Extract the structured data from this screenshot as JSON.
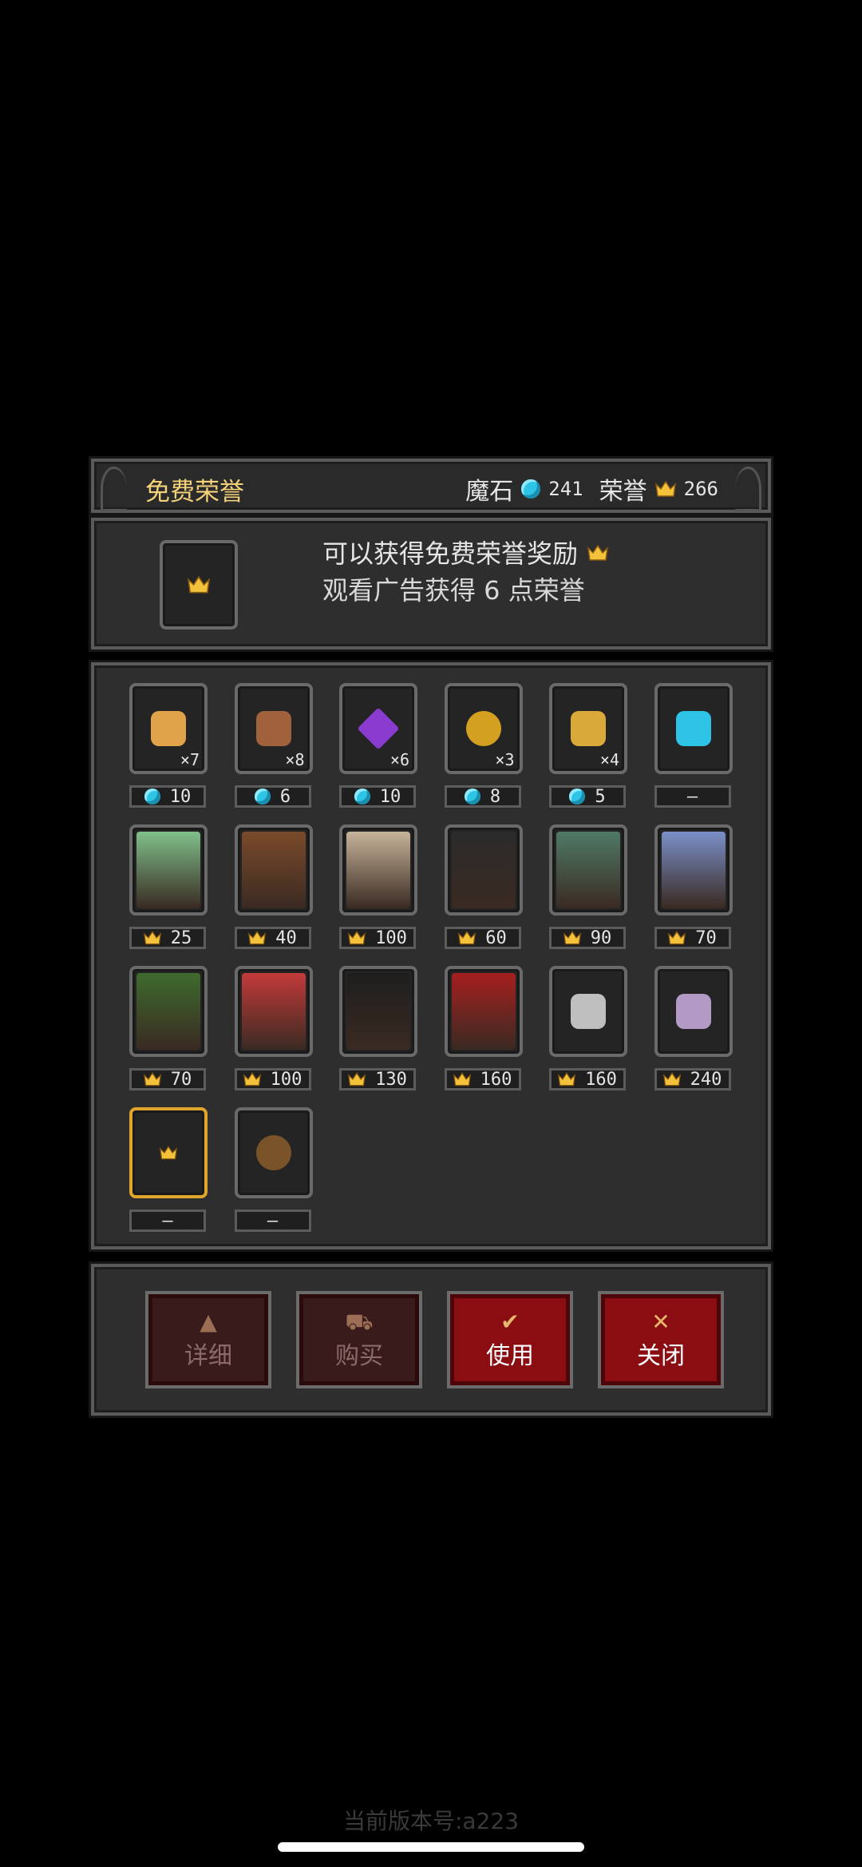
{
  "header": {
    "title": "免费荣誉",
    "magic_stone_label": "魔石",
    "magic_stone_value": "241",
    "honor_label": "荣誉",
    "honor_value": "266"
  },
  "info": {
    "line1": "可以获得免费荣誉奖励",
    "line2": "观看广告获得 6 点荣誉"
  },
  "items": [
    {
      "name": "gold-bars",
      "qty": "×7",
      "currency": "gem",
      "price": "10",
      "color": "#e0a34a"
    },
    {
      "name": "heart-scroll",
      "qty": "×8",
      "currency": "gem",
      "price": "6",
      "color": "#a0613c"
    },
    {
      "name": "purple-crystal",
      "qty": "×6",
      "currency": "gem",
      "price": "10",
      "color": "#8a3bd0"
    },
    {
      "name": "golden-apple",
      "qty": "×3",
      "currency": "gem",
      "price": "8",
      "color": "#d4a020"
    },
    {
      "name": "golden-bell",
      "qty": "×4",
      "currency": "gem",
      "price": "5",
      "color": "#d9a93a"
    },
    {
      "name": "honor-to-gem",
      "qty": "",
      "currency": "none",
      "price": "—",
      "color": "#2ec4e6"
    },
    {
      "name": "green-slime",
      "qty": "",
      "currency": "crown",
      "price": "25",
      "color": "#7fc08a"
    },
    {
      "name": "tree-monster",
      "qty": "",
      "currency": "crown",
      "price": "40",
      "color": "#7a4a2a"
    },
    {
      "name": "armored-knight",
      "qty": "",
      "currency": "crown",
      "price": "100",
      "color": "#c7b39a"
    },
    {
      "name": "hooded-reaper",
      "qty": "",
      "currency": "crown",
      "price": "60",
      "color": "#2b2b2b"
    },
    {
      "name": "zombie-shield",
      "qty": "",
      "currency": "crown",
      "price": "90",
      "color": "#4f7a66"
    },
    {
      "name": "blue-priestess",
      "qty": "",
      "currency": "crown",
      "price": "70",
      "color": "#7a8fc8"
    },
    {
      "name": "forest-ent",
      "qty": "",
      "currency": "crown",
      "price": "70",
      "color": "#3e6b2e"
    },
    {
      "name": "blonde-vampire",
      "qty": "",
      "currency": "crown",
      "price": "100",
      "color": "#c23a3a"
    },
    {
      "name": "dark-cultist",
      "qty": "",
      "currency": "crown",
      "price": "130",
      "color": "#1e1e1e"
    },
    {
      "name": "red-demon-mage",
      "qty": "",
      "currency": "crown",
      "price": "160",
      "color": "#a61f1f"
    },
    {
      "name": "crossed-swords",
      "qty": "",
      "currency": "crown",
      "price": "160",
      "color": "#bfbfbf"
    },
    {
      "name": "hourglass",
      "qty": "",
      "currency": "crown",
      "price": "240",
      "color": "#b39ac4"
    },
    {
      "name": "free-honor",
      "qty": "",
      "currency": "none",
      "price": "—",
      "color": "#f3c23a",
      "selected": true
    },
    {
      "name": "honor-bag",
      "qty": "",
      "currency": "none",
      "price": "—",
      "color": "#7a5428"
    }
  ],
  "buttons": {
    "details": "详细",
    "buy": "购买",
    "use": "使用",
    "close": "关闭"
  },
  "version": "当前版本号:a223"
}
